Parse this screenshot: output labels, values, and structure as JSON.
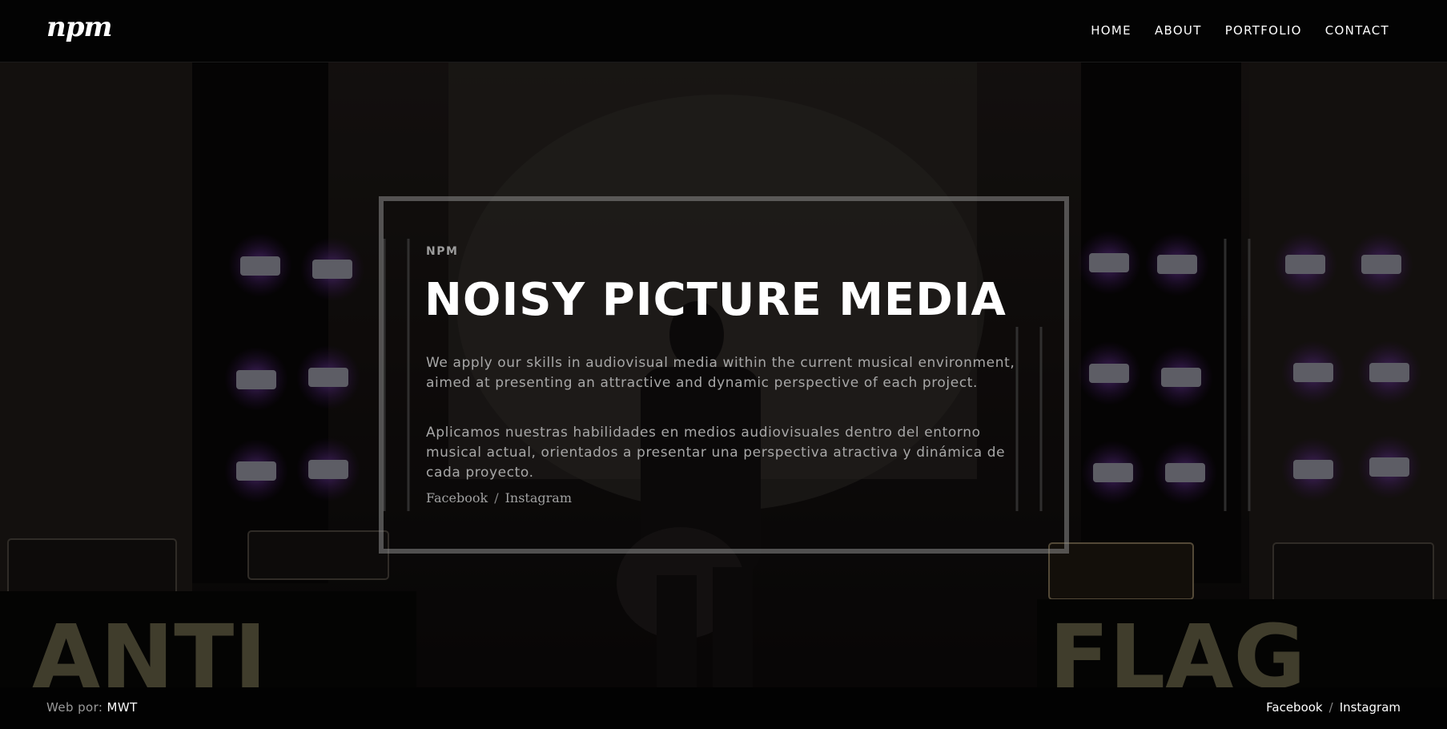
{
  "header": {
    "logo": "npm",
    "nav": [
      "HOME",
      "ABOUT",
      "PORTFOLIO",
      "CONTACT"
    ]
  },
  "hero": {
    "eyebrow": "NPM",
    "title": "NOISY PICTURE MEDIA",
    "paragraph_en": "We apply our skills in audiovisual media within the current musical environment, aimed at presenting an attractive and dynamic perspective of each project.",
    "paragraph_es": "Aplicamos nuestras habilidades en medios audiovisuales dentro del entorno musical actual, orientados a presentar una perspectiva atractiva y dinámica de cada proyecto.",
    "social": {
      "facebook": "Facebook",
      "separator": "/",
      "instagram": "Instagram"
    }
  },
  "footer": {
    "credit_prefix": "Web por:",
    "credit_link": "MWT",
    "social": {
      "facebook": "Facebook",
      "separator": "/",
      "instagram": "Instagram"
    }
  },
  "colors": {
    "background": "#000000",
    "accent_lights": "#7a2fb0",
    "frame": "#8c8c8c"
  }
}
